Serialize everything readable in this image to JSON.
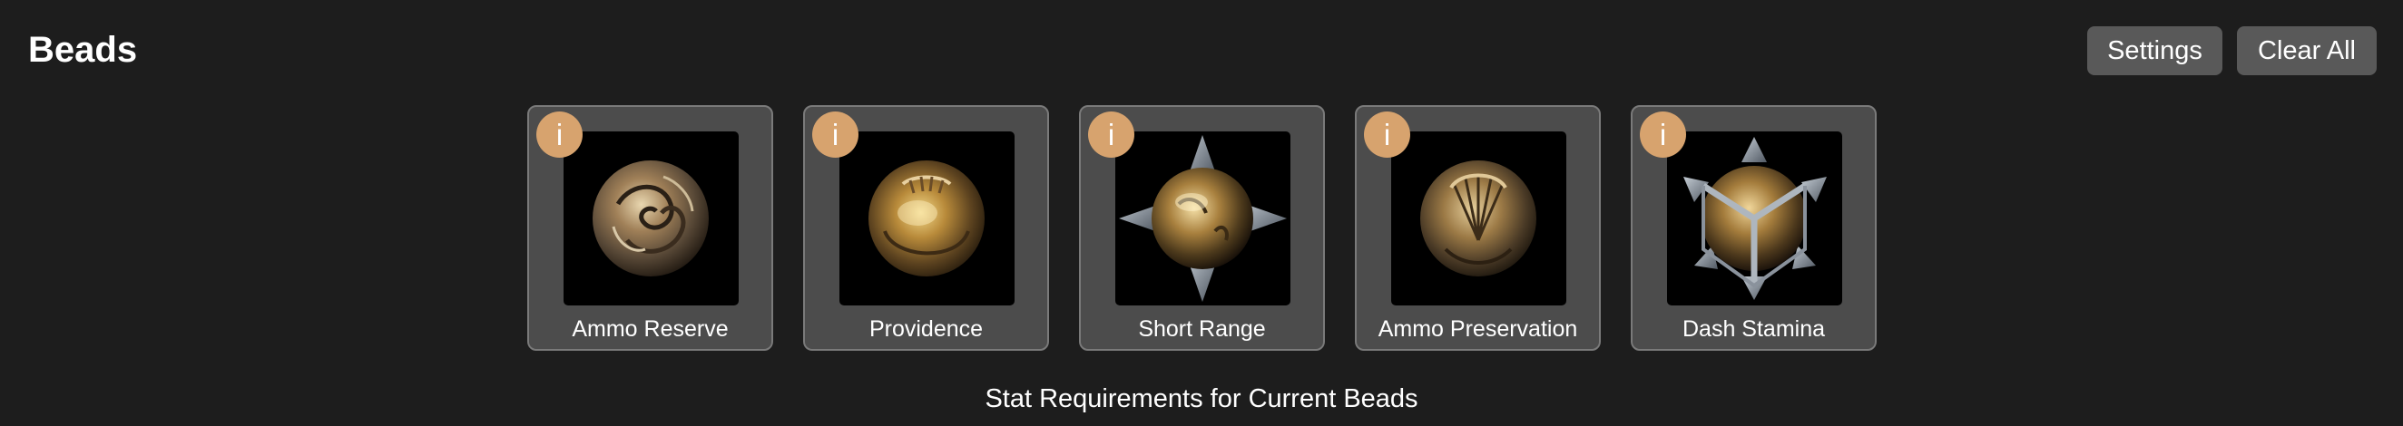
{
  "header": {
    "title": "Beads",
    "settings_label": "Settings",
    "clear_all_label": "Clear All"
  },
  "beads": [
    {
      "name": "Ammo Reserve",
      "icon": "ornate-swirl-bead-icon",
      "info_label": "i"
    },
    {
      "name": "Providence",
      "icon": "gold-crest-bead-icon",
      "info_label": "i"
    },
    {
      "name": "Short Range",
      "icon": "spiked-star-bead-icon",
      "info_label": "i"
    },
    {
      "name": "Ammo Preservation",
      "icon": "shell-pattern-bead-icon",
      "info_label": "i"
    },
    {
      "name": "Dash Stamina",
      "icon": "caged-spiked-bead-icon",
      "info_label": "i"
    }
  ],
  "footer": {
    "stat_requirements_label": "Stat Requirements for Current Beads"
  },
  "colors": {
    "background": "#1d1d1d",
    "card": "#4c4c4c",
    "info_badge": "#d7a36e",
    "button": "#595959"
  }
}
